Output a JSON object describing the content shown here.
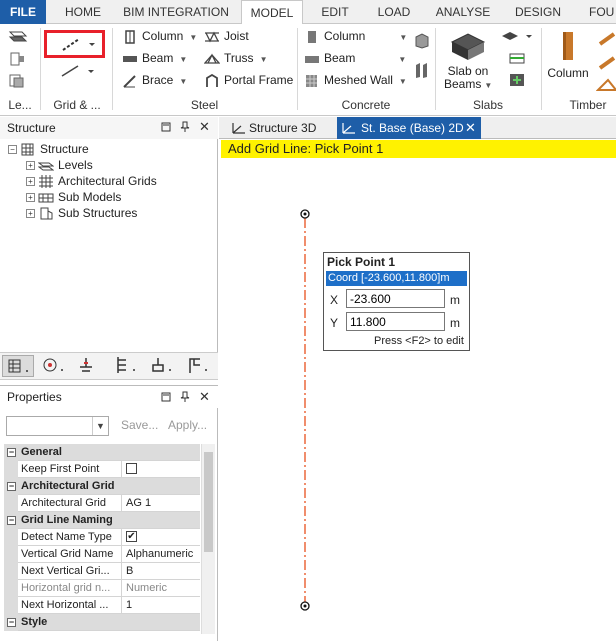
{
  "ribbon_tabs": [
    "FILE",
    "HOME",
    "BIM INTEGRATION",
    "MODEL",
    "EDIT",
    "LOAD",
    "ANALYSE",
    "DESIGN",
    "FOU"
  ],
  "active_tab": "MODEL",
  "ribbon": {
    "groups": {
      "levels": "Le...",
      "grid": "Grid & ...",
      "steel": "Steel",
      "concrete": "Concrete",
      "slabs": "Slabs",
      "timber": "Timber"
    },
    "steel": {
      "column": "Column",
      "beam": "Beam",
      "brace": "Brace",
      "joist": "Joist",
      "truss": "Truss",
      "portal": "Portal Frame"
    },
    "concrete": {
      "column": "Column",
      "beam": "Beam",
      "meshed_wall": "Meshed Wall"
    },
    "slabs": {
      "slab_on_beams_1": "Slab on",
      "slab_on_beams_2": "Beams"
    },
    "timber": {
      "column": "Column"
    },
    "highlight_color": "#e8202a"
  },
  "structure_panel": {
    "title": "Structure",
    "root": "Structure",
    "items": [
      "Levels",
      "Architectural Grids",
      "Sub Models",
      "Sub Structures"
    ]
  },
  "properties_panel": {
    "title": "Properties",
    "save": "Save...",
    "apply": "Apply...",
    "categories": {
      "general": "General",
      "arch_grid": "Architectural Grid",
      "naming": "Grid Line Naming",
      "style": "Style"
    },
    "rows": {
      "keep_first_point": "Keep First Point",
      "architectural_grid_key": "Architectural Grid",
      "architectural_grid_val": "AG 1",
      "detect_name_type": "Detect Name Type",
      "vertical_grid_name_key": "Vertical Grid Name",
      "vertical_grid_name_val": "Alphanumeric",
      "next_vertical_key": "Next Vertical Gri...",
      "next_vertical_val": "B",
      "horizontal_grid_key": "Horizontal grid n...",
      "horizontal_grid_val": "Numeric",
      "next_horizontal_key": "Next Horizontal ...",
      "next_horizontal_val": "1"
    },
    "keep_first_point_checked": false,
    "detect_name_type_checked": true
  },
  "doc_tabs": [
    "Structure 3D",
    "St. Base (Base) 2D"
  ],
  "active_doc_tab": "St. Base (Base) 2D",
  "command_prompt": "Add Grid Line: Pick Point 1",
  "prompt_color": "#fff200",
  "pick_point": {
    "title": "Pick Point 1",
    "coord": "Coord [-23.600,11.800]m",
    "x_label": "X",
    "x_value": "-23.600",
    "y_label": "Y",
    "y_value": "11.800",
    "unit": "m",
    "hint": "Press <F2> to edit"
  },
  "grid_line_color": "#e8501e",
  "accent_color": "#1e5ea8"
}
